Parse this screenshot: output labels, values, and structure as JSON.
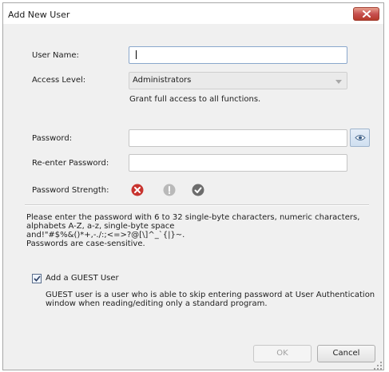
{
  "window": {
    "title": "Add New User"
  },
  "form": {
    "user_name_label": "User Name:",
    "user_name_value": "",
    "access_level_label": "Access Level:",
    "access_level_value": "Administrators",
    "access_level_description": "Grant full access to all functions.",
    "password_label": "Password:",
    "reenter_password_label": "Re-enter Password:",
    "password_strength_label": "Password Strength:"
  },
  "strength_icons": [
    "error-x-icon",
    "warning-exclamation-icon",
    "check-icon"
  ],
  "instructions": {
    "line1": "Please enter the password with 6 to 32 single-byte characters, numeric characters,",
    "line2": "alphabets A-Z, a-z, single-byte space",
    "line3": "and!\"#$%&()*+,-./:;<=>?@[\\]^_`{|}~.",
    "line4": "Passwords are case-sensitive."
  },
  "guest": {
    "checkbox_label": "Add a GUEST User",
    "checked": true,
    "description_line1": "GUEST user is a user who is able to skip entering password at User Authentication",
    "description_line2": "window when reading/editing only a standard program."
  },
  "buttons": {
    "ok": "OK",
    "cancel": "Cancel"
  },
  "colors": {
    "error": "#c8342f",
    "warning": "#b9b9b9",
    "ok": "#6c6c6c",
    "close": "#c75050"
  }
}
